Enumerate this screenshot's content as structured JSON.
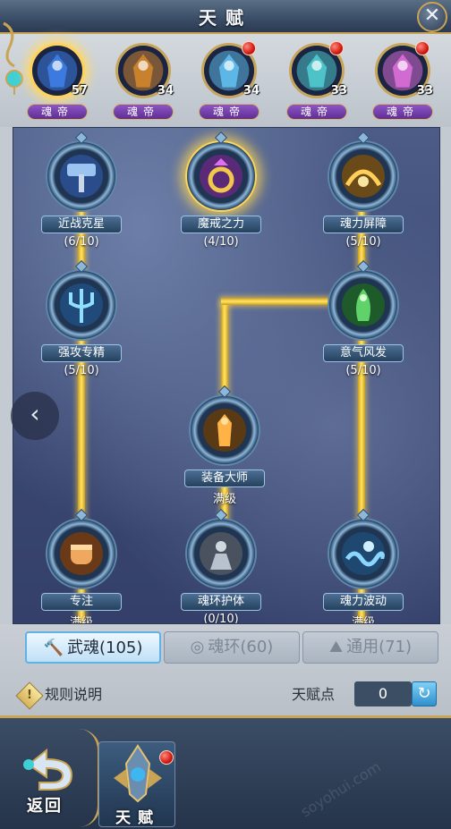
{
  "header": {
    "title": "天赋",
    "close_icon": "close-icon"
  },
  "heroes": [
    {
      "level": "57",
      "rank": "魂帝",
      "selected": true,
      "has_notice": false,
      "color": "#3d7ae0"
    },
    {
      "level": "34",
      "rank": "魂帝",
      "selected": false,
      "has_notice": false,
      "color": "#c9812e"
    },
    {
      "level": "34",
      "rank": "魂帝",
      "selected": false,
      "has_notice": true,
      "color": "#5db7e6"
    },
    {
      "level": "33",
      "rank": "魂帝",
      "selected": false,
      "has_notice": true,
      "color": "#4dc3c9"
    },
    {
      "level": "33",
      "rank": "魂帝",
      "selected": false,
      "has_notice": true,
      "color": "#d16ad1"
    }
  ],
  "talent_tree": {
    "nodes": [
      {
        "id": "melee",
        "label": "近战克星",
        "progress": "(6/10)",
        "icon": "hammer-icon",
        "active": false
      },
      {
        "id": "ring",
        "label": "魔戒之力",
        "progress": "(4/10)",
        "icon": "ring-icon",
        "active": true
      },
      {
        "id": "barrier",
        "label": "魂力屏障",
        "progress": "(5/10)",
        "icon": "barrier-icon",
        "active": false
      },
      {
        "id": "strike",
        "label": "强攻专精",
        "progress": "(5/10)",
        "icon": "trident-icon",
        "active": false
      },
      {
        "id": "spirit",
        "label": "意气风发",
        "progress": "(5/10)",
        "icon": "spirit-icon",
        "active": false
      },
      {
        "id": "equip",
        "label": "装备大师",
        "progress": "满级",
        "icon": "equipment-icon",
        "active": false
      },
      {
        "id": "focus",
        "label": "专注",
        "progress": "满级",
        "icon": "fist-icon",
        "active": false
      },
      {
        "id": "guard",
        "label": "魂环护体",
        "progress": "(0/10)",
        "icon": "guard-icon",
        "active": false
      },
      {
        "id": "wave",
        "label": "魂力波动",
        "progress": "满级",
        "icon": "wave-icon",
        "active": false
      }
    ],
    "nav_prev_icon": "chevron-left-icon",
    "line_color": "#ffd84a"
  },
  "tabs": [
    {
      "label": "武魂(105)",
      "icon": "hammer-icon",
      "selected": true
    },
    {
      "label": "魂环(60)",
      "icon": "ring-icon",
      "selected": false
    },
    {
      "label": "通用(71)",
      "icon": "meditate-icon",
      "selected": false
    }
  ],
  "rules": {
    "label": "规则说明",
    "icon": "warning-icon"
  },
  "points": {
    "label": "天赋点",
    "value": "0",
    "refresh_icon": "refresh-icon"
  },
  "footer": {
    "back_label": "返回",
    "talent_label": "天赋",
    "watermark": "soyohui.com"
  }
}
